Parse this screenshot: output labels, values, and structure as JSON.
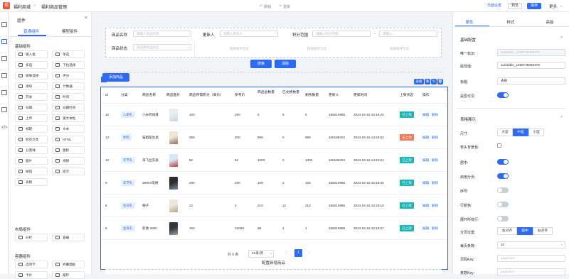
{
  "topbar": {
    "app_name": "福利商城",
    "page_name": "福利商品管理",
    "undo_label": "撤销",
    "redo_label": "重做",
    "page_settings_label": "页面设置",
    "preview_label": "预览",
    "save_label": "保存",
    "more_label": "更多"
  },
  "components_panel": {
    "title": "组件",
    "close_glyph": "×",
    "tabs": [
      "普通组件",
      "模型组件"
    ],
    "sections": [
      {
        "title": "基础组件",
        "items": [
          "输入框",
          "单选",
          "多选",
          "下拉选择",
          "级联选择",
          "评分",
          "滑块",
          "计数器",
          "开关",
          "时间",
          "日期",
          "日期时间",
          "上传",
          "富文本框",
          "帧轭",
          "文本",
          "标签文本",
          "HTML",
          "分割线",
          "图标",
          "图片",
          "视频",
          "按钮",
          "提示",
          "表格"
        ]
      },
      {
        "title": "布局组件",
        "items": [
          "分栏",
          "容器"
        ]
      },
      {
        "title": "容器组件",
        "items": [
          "选项卡",
          "折叠面板",
          "卡片",
          "循环"
        ]
      }
    ]
  },
  "search_form": {
    "fields": [
      {
        "label": "商品名称",
        "placeholder": "请输入商品名称"
      },
      {
        "label": "更新人",
        "placeholder": "请输入更新人"
      },
      {
        "label": "积分范围",
        "placeholder": "请输入积分范围"
      },
      {
        "label": "",
        "placeholder": "请输入..."
      },
      {
        "label": "商品状态",
        "placeholder": "请选择商品状态"
      }
    ],
    "dash": "-",
    "empty_hint": "拖拽组件至此",
    "search_label": "搜索",
    "reset_label": "清除"
  },
  "add_button_label": "添加商品",
  "table_badge_label": "表格",
  "table": {
    "columns": [
      "id",
      "分类",
      "商品名称",
      "商品图片",
      "商品所需积分（单价）",
      "参考价",
      "商品总数量",
      "已兑换数量",
      "剩余数量",
      "更新人",
      "更新时间",
      "上架状态",
      "操作"
    ],
    "rows": [
      {
        "id": "10",
        "category": "入职礼",
        "name": "小米有线耳",
        "points": "100",
        "price": "200",
        "total": "5",
        "exchanged": "5",
        "remain": "5",
        "updater": "155010985",
        "time": "2024-04-15 10:18:25",
        "status": "已上架",
        "status_color": "#1bb5b5"
      },
      {
        "id": "13",
        "category": "体检",
        "name": "猫姐医生桌",
        "points": "256",
        "price": "300",
        "total": "999",
        "exchanged": "0",
        "remain": "999",
        "updater": "166198202",
        "time": "2024-04-15 14:25:52",
        "status": "未上架",
        "status_color": "#f07b5a"
      },
      {
        "id": "12",
        "category": "年节礼",
        "name": "海飞丝洗发",
        "points": "52",
        "price": "52",
        "total": "1000",
        "exchanged": "0",
        "remain": "1000",
        "updater": "166198202",
        "time": "2024-04-15 14:24:24",
        "status": "已上架",
        "status_color": "#1bb5b5"
      },
      {
        "id": "9",
        "category": "年节礼",
        "name": "3990X笔楼",
        "points": "200",
        "price": "200",
        "total": "109",
        "exchanged": "2",
        "remain": "109",
        "updater": "155010985",
        "time": "2024-04-15 10:19:30",
        "status": "已上架",
        "status_color": "#1bb5b5"
      },
      {
        "id": "8",
        "category": "生日礼",
        "name": "帽子",
        "points": "22",
        "price": "2",
        "total": "210",
        "exchanged": "12",
        "remain": "210",
        "updater": "155010985",
        "time": "2024-04-15 10:19:18",
        "status": "已上架",
        "status_color": "#1bb5b5"
      },
      {
        "id": "6",
        "category": "生育礼",
        "name": "影驰 4090",
        "points": "150",
        "price": "15000",
        "total": "99",
        "exchanged": "1",
        "remain": "1",
        "updater": "155010985",
        "time": "2024-04-15 10:19:07",
        "status": "已上架",
        "status_color": "#1bb5b5"
      }
    ],
    "edit_label": "编辑",
    "delete_label": "删除"
  },
  "pagination": {
    "total_label": "共 6 条",
    "page_size": "10条/页",
    "prev": "‹",
    "next": "›",
    "current": "1"
  },
  "bottom_hint": "配置新增商品",
  "properties_panel": {
    "tabs": [
      "属性",
      "样式",
      "高级"
    ],
    "basic_section": "基础配置",
    "unique_id_label": "唯一标识:",
    "unique_id_value": "autotable_1698745086378",
    "prop_value_label": "属性值:",
    "prop_value_value": "autotable_1698745086378",
    "title_label": "标题:",
    "title_value": "表格",
    "visible_label": "是否可见:",
    "table_section": "表格展示",
    "size_label": "尺寸:",
    "size_options": [
      "大型",
      "中型",
      "小型"
    ],
    "size_selected": "中型",
    "header_bg_label": "表头背景色:",
    "center_label": "居中:",
    "paging_label": "启用分页:",
    "serial_label": "序号:",
    "stripe_label": "行颜色:",
    "expand_label": "展开所有行:",
    "page_pos_label": "分页位置:",
    "page_pos_options": [
      "左对齐",
      "居中",
      "右对齐"
    ],
    "page_pos_selected": "居中",
    "page_count_label": "每页条数:",
    "page_count_value": "10",
    "page_key_label": "页码Key:",
    "page_key_placeholder": "pageNum",
    "size_key_label": "条数Key:",
    "size_key_placeholder": "pageSize"
  },
  "colors": {
    "primary": "#2f6bf0",
    "brand": "#e8572d",
    "listed": "#1bb5b5",
    "unlisted": "#f07b5a"
  }
}
